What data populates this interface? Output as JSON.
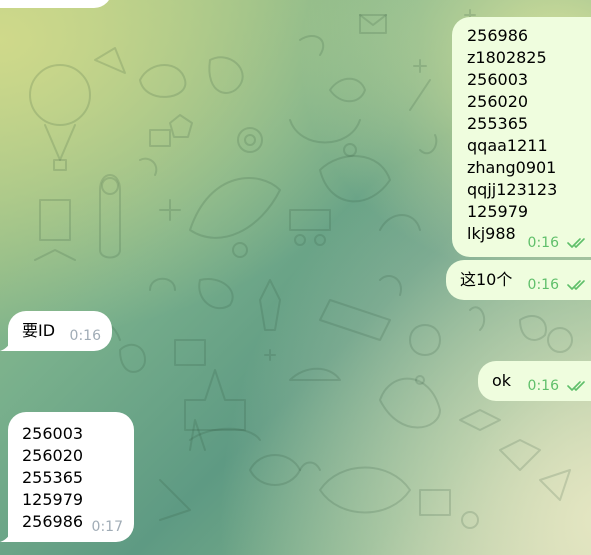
{
  "messages": [
    {
      "id": "m1",
      "dir": "in",
      "lines": [],
      "time": ""
    },
    {
      "id": "m2",
      "dir": "out",
      "lines": [
        "256986",
        "z1802825",
        "256003",
        "256020",
        "255365",
        "qqaa1211",
        "zhang0901",
        "qqjj123123",
        "125979",
        "lkj988"
      ],
      "time": "0:16",
      "read": true
    },
    {
      "id": "m3",
      "dir": "out",
      "lines": [
        "这10个"
      ],
      "time": "0:16",
      "read": true
    },
    {
      "id": "m4",
      "dir": "in",
      "lines": [
        "要ID"
      ],
      "time": "0:16"
    },
    {
      "id": "m5",
      "dir": "out",
      "lines": [
        "ok"
      ],
      "time": "0:16",
      "read": true
    },
    {
      "id": "m6",
      "dir": "in",
      "lines": [
        "256003",
        "256020",
        "255365",
        "125979",
        "256986"
      ],
      "time": "0:17"
    }
  ],
  "colors": {
    "incoming_bubble": "#ffffff",
    "outgoing_bubble": "#effdde",
    "outgoing_meta": "#5fbf6a",
    "incoming_meta": "#a0acb6"
  }
}
